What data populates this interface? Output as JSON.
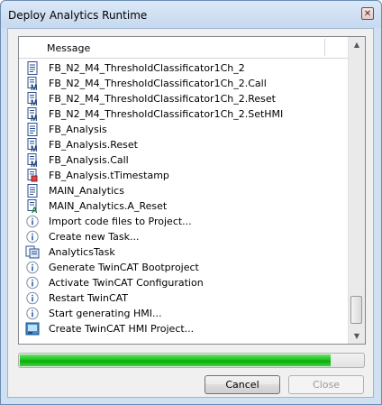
{
  "window": {
    "title": "Deploy Analytics Runtime"
  },
  "list": {
    "header": "Message",
    "rows": [
      {
        "icon": "document-icon",
        "text": "FB_N2_M4_ThresholdClassificator1Ch_2"
      },
      {
        "icon": "method-icon",
        "text": "FB_N2_M4_ThresholdClassificator1Ch_2.Call"
      },
      {
        "icon": "method-icon",
        "text": "FB_N2_M4_ThresholdClassificator1Ch_2.Reset"
      },
      {
        "icon": "method-icon",
        "text": "FB_N2_M4_ThresholdClassificator1Ch_2.SetHMI"
      },
      {
        "icon": "document-icon",
        "text": "FB_Analysis"
      },
      {
        "icon": "method-icon",
        "text": "FB_Analysis.Reset"
      },
      {
        "icon": "method-icon",
        "text": "FB_Analysis.Call"
      },
      {
        "icon": "property-icon",
        "text": "FB_Analysis.tTimestamp"
      },
      {
        "icon": "document-icon",
        "text": "MAIN_Analytics"
      },
      {
        "icon": "action-icon",
        "text": "MAIN_Analytics.A_Reset"
      },
      {
        "icon": "info-icon",
        "text": "Import code files to Project..."
      },
      {
        "icon": "info-icon",
        "text": "Create new Task..."
      },
      {
        "icon": "task-icon",
        "text": "AnalyticsTask"
      },
      {
        "icon": "info-icon",
        "text": "Generate TwinCAT Bootproject"
      },
      {
        "icon": "info-icon",
        "text": "Activate TwinCAT Configuration"
      },
      {
        "icon": "info-icon",
        "text": "Restart TwinCAT"
      },
      {
        "icon": "info-icon",
        "text": "Start generating HMI..."
      },
      {
        "icon": "hmi-icon",
        "text": "Create TwinCAT HMI Project..."
      }
    ]
  },
  "progress": {
    "value": 0.905,
    "color": "#1ec41e"
  },
  "buttons": {
    "cancel": "Cancel",
    "close": "Close"
  }
}
